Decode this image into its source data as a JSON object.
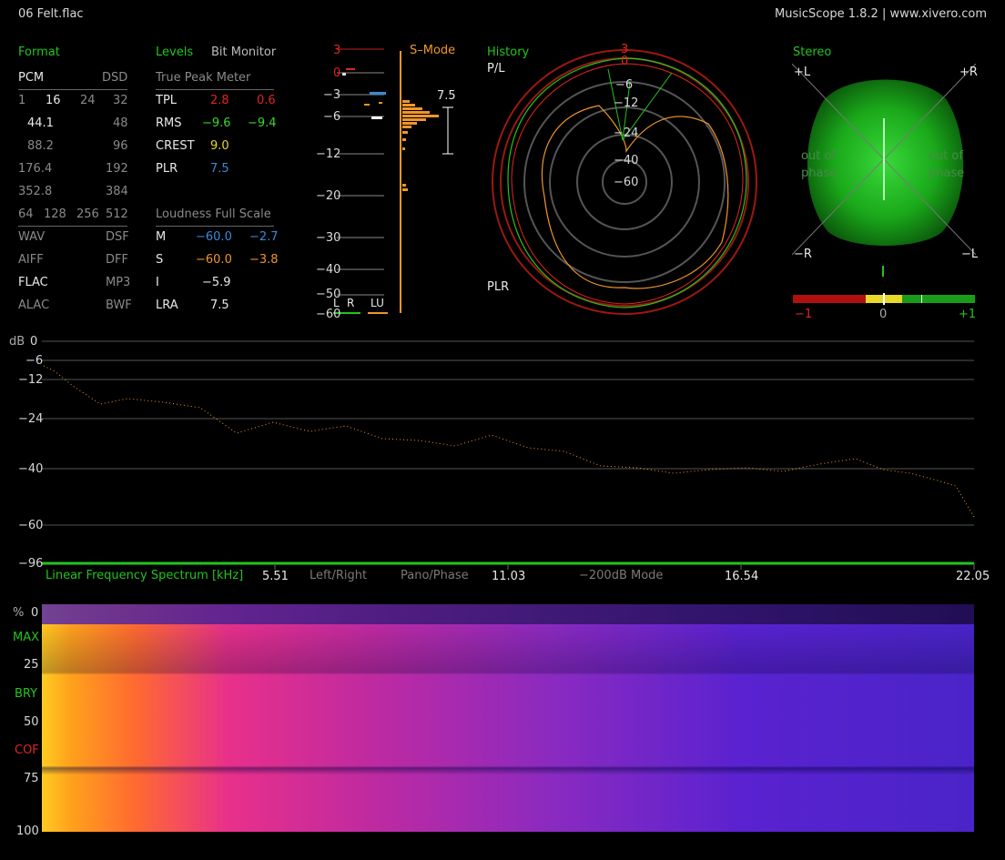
{
  "window": {
    "filename": "06 Felt.flac",
    "app_info": "MusicScope 1.8.2 | www.xivero.com"
  },
  "format": {
    "title": "Format",
    "pcm": "PCM",
    "dsd": "DSD",
    "bits": [
      "1",
      "16",
      "24",
      "32"
    ],
    "rates_pcm": [
      "44.1",
      "88.2",
      "176.4",
      "352.8"
    ],
    "rates_dsd": [
      "48",
      "96",
      "192",
      "384"
    ],
    "dsd_rates": [
      "64",
      "128",
      "256",
      "512"
    ],
    "types_left": [
      "WAV",
      "AIFF",
      "FLAC",
      "ALAC"
    ],
    "types_right": [
      "DSF",
      "DFF",
      "MP3",
      "BWF"
    ]
  },
  "levels": {
    "title": "Levels",
    "bit_monitor": "Bit Monitor",
    "tpm_title": "True Peak Meter",
    "rows": [
      {
        "label": "TPL",
        "l": "2.8",
        "r": "0.6"
      },
      {
        "label": "RMS",
        "l": "−9.6",
        "r": "−9.4"
      },
      {
        "label": "CREST",
        "l": "9.0",
        "r": ""
      },
      {
        "label": "PLR",
        "l": "7.5",
        "r": ""
      }
    ],
    "lfs_title": "Loudness Full Scale",
    "lfs_rows": [
      {
        "label": "M",
        "l": "−60.0",
        "r": "−2.7"
      },
      {
        "label": "S",
        "l": "−60.0",
        "r": "−3.8"
      },
      {
        "label": "I",
        "l": "−5.9",
        "r": ""
      },
      {
        "label": "LRA",
        "l": "7.5",
        "r": ""
      }
    ]
  },
  "meter": {
    "mode": "S–Mode",
    "ticks": [
      "3",
      "0",
      "−3",
      "−6",
      "−12",
      "−20",
      "−30",
      "−40",
      "−50",
      "−60"
    ],
    "plr_value": "7.5",
    "labels": [
      "L",
      "R",
      "LU"
    ]
  },
  "history": {
    "title": "History",
    "top_label": "P/L",
    "bottom_label": "PLR",
    "ring_labels": [
      "3",
      "0",
      "−6",
      "−12",
      "−24",
      "−40",
      "−60"
    ]
  },
  "stereo": {
    "title": "Stereo",
    "corners": [
      "+L",
      "+R",
      "−R",
      "−L"
    ],
    "out_of_phase": [
      "out of",
      "phase"
    ],
    "correlation_ticks": [
      "−1",
      "0",
      "+1"
    ],
    "correlation_value": 0.25
  },
  "spectrum": {
    "ylabel": "dB",
    "yticks": [
      "0",
      "−6",
      "−12",
      "−24",
      "−40",
      "−60",
      "−96"
    ],
    "title": "Linear Frequency Spectrum [kHz]",
    "xticks": [
      "5.51",
      "11.03",
      "16.54",
      "22.05"
    ],
    "modes": [
      "Left/Right",
      "Pano/Phase",
      "−200dB Mode"
    ]
  },
  "spectrogram": {
    "yticks": [
      "%",
      "0",
      "25",
      "50",
      "75",
      "100"
    ],
    "side_labels": [
      "MAX",
      "BRY",
      "COF"
    ]
  },
  "colors": {
    "accent_green": "#22c41c",
    "tpl_red": "#e0261c",
    "loudness_orange": "#f0962a",
    "m_blue": "#3a8ad8"
  }
}
